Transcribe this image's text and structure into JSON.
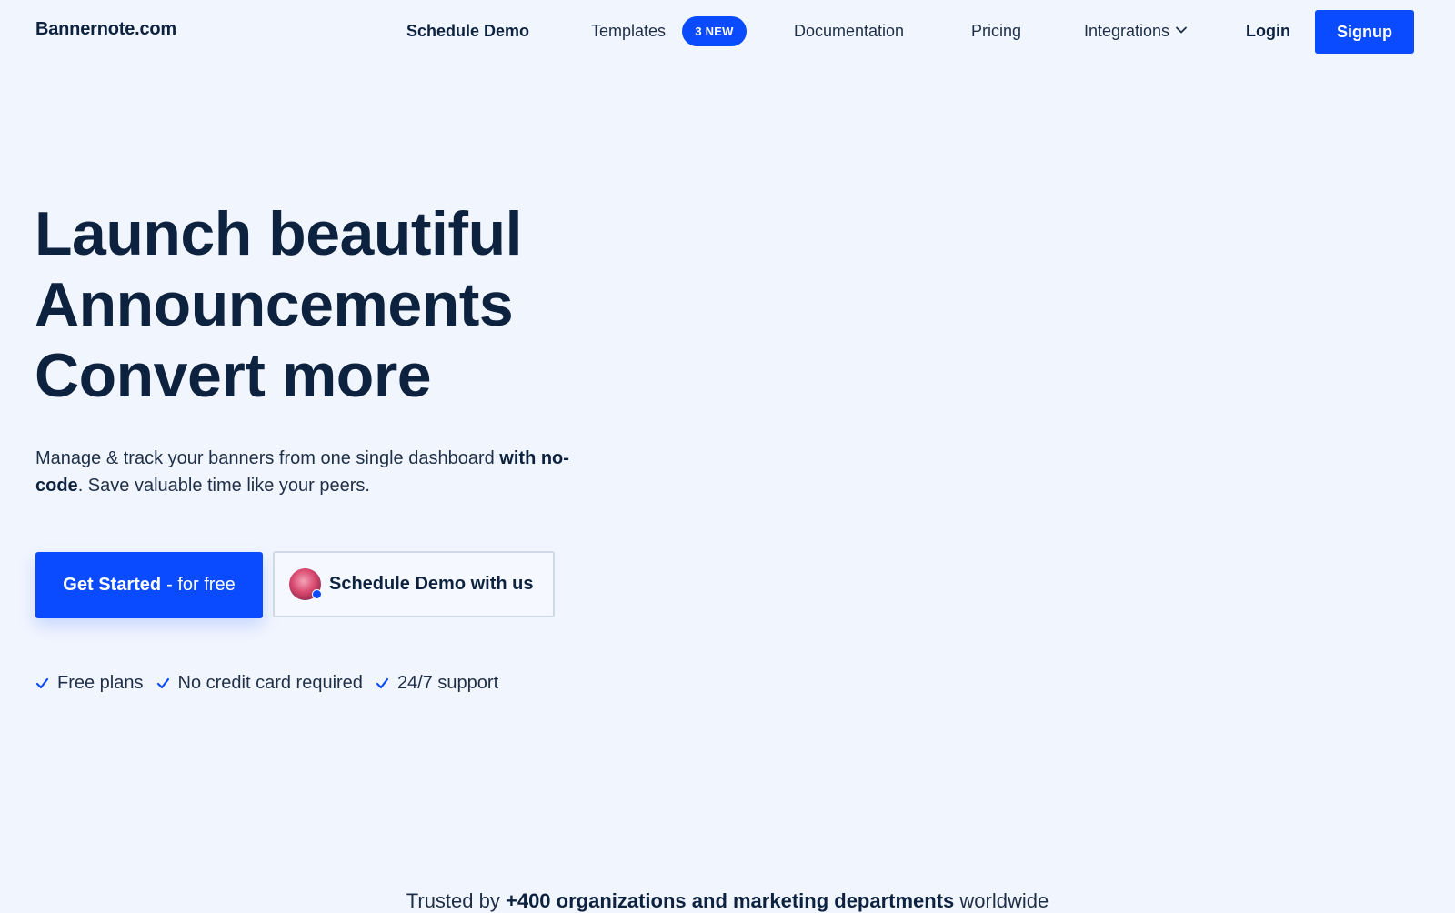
{
  "header": {
    "brand": "Bannernote.com",
    "nav": {
      "schedule_demo": "Schedule Demo",
      "templates": "Templates",
      "templates_badge": "3 NEW",
      "documentation": "Documentation",
      "pricing": "Pricing",
      "integrations": "Integrations",
      "login": "Login",
      "signup": "Signup"
    }
  },
  "hero": {
    "title_lines": [
      "Launch beautiful",
      "Announcements",
      "Convert more"
    ],
    "subtitle": {
      "part1": "Manage & track your banners from one single dashboard ",
      "bold1": "with no-code",
      "part2": ". Save valuable time like your peers."
    },
    "cta_primary": {
      "bold": "Get Started",
      "rest": "- for free"
    },
    "cta_secondary": "Schedule Demo with us",
    "features": [
      "Free plans",
      "No credit card required",
      "24/7 support"
    ]
  },
  "trusted": {
    "prefix": "Trusted by ",
    "bold": "+400 organizations and marketing departments",
    "suffix": " worldwide"
  },
  "icons": {
    "integrations_dropdown": "chevron-down-icon",
    "feature_check": "check-icon",
    "demo_avatar": "avatar"
  },
  "colors": {
    "accent": "#0a4bff",
    "background": "#f1f5fe",
    "text_dark": "#0d223f"
  }
}
